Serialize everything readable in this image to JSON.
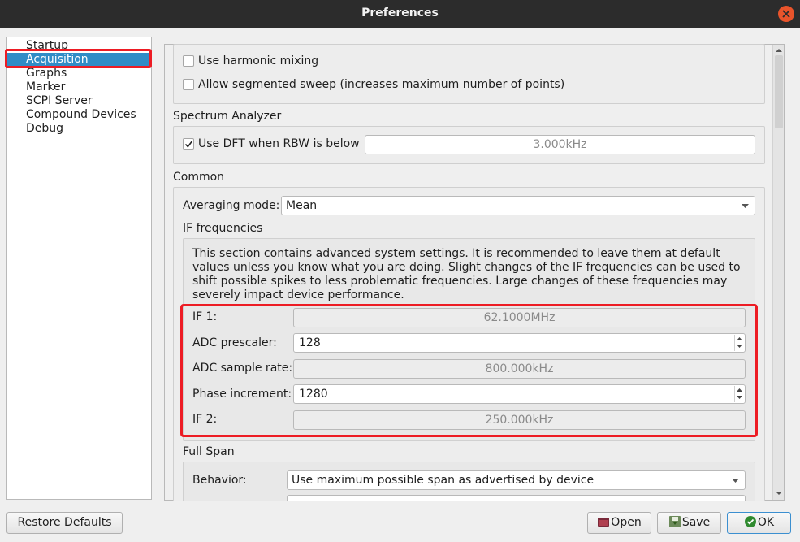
{
  "window": {
    "title": "Preferences"
  },
  "pages": [
    {
      "label": "Startup"
    },
    {
      "label": "Acquisition"
    },
    {
      "label": "Graphs"
    },
    {
      "label": "Marker"
    },
    {
      "label": "SCPI Server"
    },
    {
      "label": "Compound Devices"
    },
    {
      "label": "Debug"
    }
  ],
  "selected_page": "Acquisition",
  "acquisition": {
    "use_harmonic_mixing": {
      "label": "Use harmonic mixing",
      "checked": false
    },
    "allow_segmented_sweep": {
      "label": "Allow segmented sweep (increases maximum number of points)",
      "checked": false
    },
    "spectrum_analyzer": {
      "title": "Spectrum Analyzer",
      "use_dft": {
        "label": "Use DFT when RBW is below",
        "checked": true
      },
      "dft_threshold": "3.000kHz"
    },
    "common": {
      "title": "Common",
      "averaging_mode_label": "Averaging mode:",
      "averaging_mode_value": "Mean",
      "if_frequencies": {
        "title": "IF frequencies",
        "description": "This section contains advanced system settings. It is recommended to leave them at default values unless you know what you are doing. Slight changes of the IF frequencies can be used to shift possible spikes to less problematic frequencies. Large changes of these frequencies may severely impact device performance.",
        "if1_label": "IF 1:",
        "if1_value": "62.1000MHz",
        "adc_prescaler_label": "ADC prescaler:",
        "adc_prescaler_value": "128",
        "adc_sample_rate_label": "ADC sample rate:",
        "adc_sample_rate_value": "800.000kHz",
        "phase_increment_label": "Phase increment:",
        "phase_increment_value": "1280",
        "if2_label": "IF 2:",
        "if2_value": "250.000kHz"
      }
    },
    "full_span": {
      "title": "Full Span",
      "behavior_label": "Behavior:",
      "behavior_value": "Use maximum possible span as advertised by device"
    }
  },
  "buttons": {
    "restore_defaults": "Restore Defaults",
    "open_pre": "",
    "open_u": "O",
    "open_post": "pen",
    "save_pre": "",
    "save_u": "S",
    "save_post": "ave",
    "ok_pre": "",
    "ok_u": "O",
    "ok_post": "K"
  },
  "colors": {
    "titlebar": "#2c2c2c",
    "selection": "#308cc6",
    "highlight": "#ed1c24",
    "close": "#e9542b"
  }
}
